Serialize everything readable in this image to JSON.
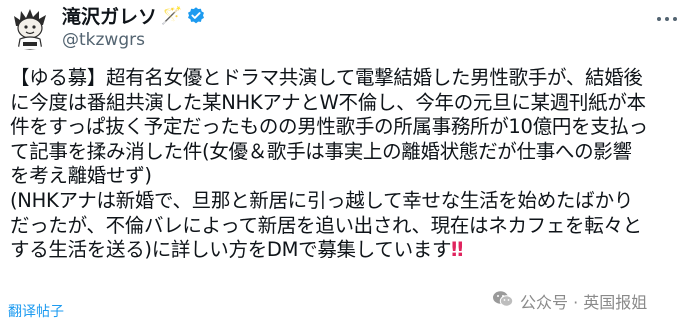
{
  "author": {
    "display_name": "滝沢ガレソ",
    "name_emoji": "🪄",
    "handle": "@tkzwgrs",
    "avatar_icon": "mascot-avatar",
    "verified_icon": "verified-badge-icon",
    "verified_color": "#1d9bf0"
  },
  "post": {
    "lines": [
      "【ゆる募】超有名女優とドラマ共演して電撃結婚した男性歌手が、結婚後",
      "に今度は番組共演した某NHKアナとW不倫し、今年の元旦に某週刊紙が本",
      "件をすっぱ抜く予定だったものの男性歌手の所属事務所が10億円を支払っ",
      "て記事を揉み消した件(女優＆歌手は事実上の離婚状態だが仕事への影響",
      "を考え離婚せず)",
      "(NHKアナは新婚で、旦那と新居に引っ越して幸せな生活を始めたばかり",
      "だったが、不倫バレによって新居を追い出され、現在はネカフェを転々と",
      "する生活を送る)に詳しい方をDMで募集しています"
    ],
    "end_mark": "‼"
  },
  "translate_label": "翻译帖子",
  "more_icon": "more-options-icon",
  "watermark": {
    "icon": "wechat-icon",
    "text": "公众号 · 英国报姐"
  }
}
